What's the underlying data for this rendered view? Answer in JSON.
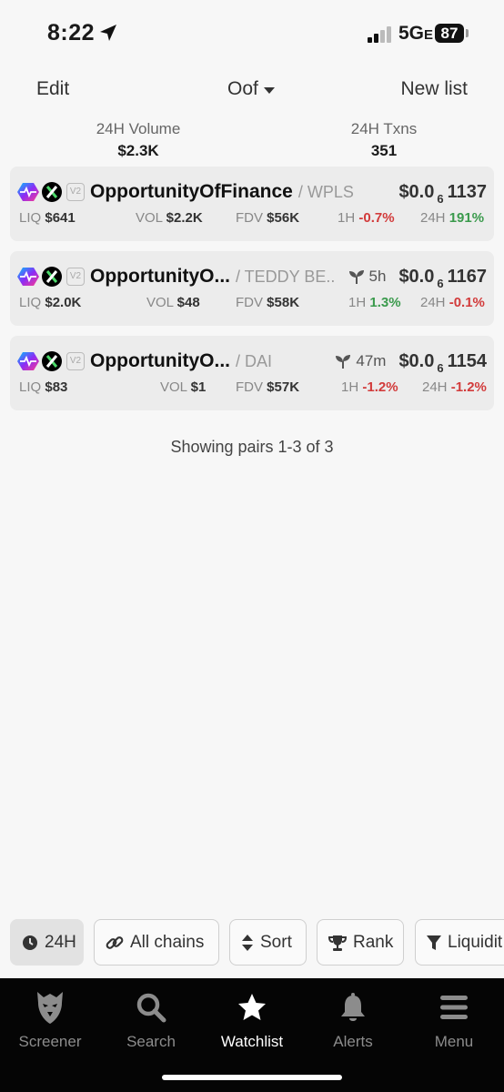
{
  "status_bar": {
    "time": "8:22",
    "network": "5G",
    "network_suffix": "E",
    "battery": "87"
  },
  "header": {
    "edit_label": "Edit",
    "list_name": "Oof",
    "new_list_label": "New list"
  },
  "stats": {
    "volume_label": "24H Volume",
    "volume_value": "$2.3K",
    "txns_label": "24H Txns",
    "txns_value": "351"
  },
  "pairs": [
    {
      "version": "V2",
      "name": "OpportunityOfFinance",
      "quote": "/ WPLS",
      "age": "",
      "price_prefix": "$0.0",
      "price_zeros": "6",
      "price_digits": "1137",
      "liq_label": "LIQ",
      "liq": "$641",
      "vol_label": "VOL",
      "vol": "$2.2K",
      "fdv_label": "FDV",
      "fdv": "$56K",
      "h1_label": "1H",
      "h1": "-0.7%",
      "h24_label": "24H",
      "h24": "191%"
    },
    {
      "version": "V2",
      "name": "OpportunityO...",
      "quote": "/ TEDDY BE..",
      "age": "5h",
      "price_prefix": "$0.0",
      "price_zeros": "6",
      "price_digits": "1167",
      "liq_label": "LIQ",
      "liq": "$2.0K",
      "vol_label": "VOL",
      "vol": "$48",
      "fdv_label": "FDV",
      "fdv": "$58K",
      "h1_label": "1H",
      "h1": "1.3%",
      "h24_label": "24H",
      "h24": "-0.1%"
    },
    {
      "version": "V2",
      "name": "OpportunityO...",
      "quote": "/ DAI",
      "age": "47m",
      "price_prefix": "$0.0",
      "price_zeros": "6",
      "price_digits": "1154",
      "liq_label": "LIQ",
      "liq": "$83",
      "vol_label": "VOL",
      "vol": "$1",
      "fdv_label": "FDV",
      "fdv": "$57K",
      "h1_label": "1H",
      "h1": "-1.2%",
      "h24_label": "24H",
      "h24": "-1.2%"
    }
  ],
  "showing_text": "Showing pairs 1-3 of 3",
  "filters": {
    "timeframe": "24H",
    "chains": "All chains",
    "sort": "Sort",
    "rank": "Rank",
    "liquidity": "Liquidit"
  },
  "nav": {
    "screener": "Screener",
    "search": "Search",
    "watchlist": "Watchlist",
    "alerts": "Alerts",
    "menu": "Menu"
  },
  "colors": {
    "positive": "#3a9a4c",
    "negative": "#d23b3b",
    "card_bg": "#ececec",
    "nav_bg": "#050505"
  },
  "icons": {
    "status": [
      "location-arrow-icon",
      "signal-icon",
      "battery-icon"
    ],
    "pair": [
      "pulsechain-icon",
      "x-token-icon",
      "sprout-icon"
    ],
    "filters": [
      "clock-icon",
      "link-icon",
      "sort-icon",
      "trophy-icon",
      "filter-icon"
    ],
    "nav": [
      "eagle-icon",
      "search-icon",
      "star-icon",
      "bell-icon",
      "menu-icon"
    ]
  }
}
